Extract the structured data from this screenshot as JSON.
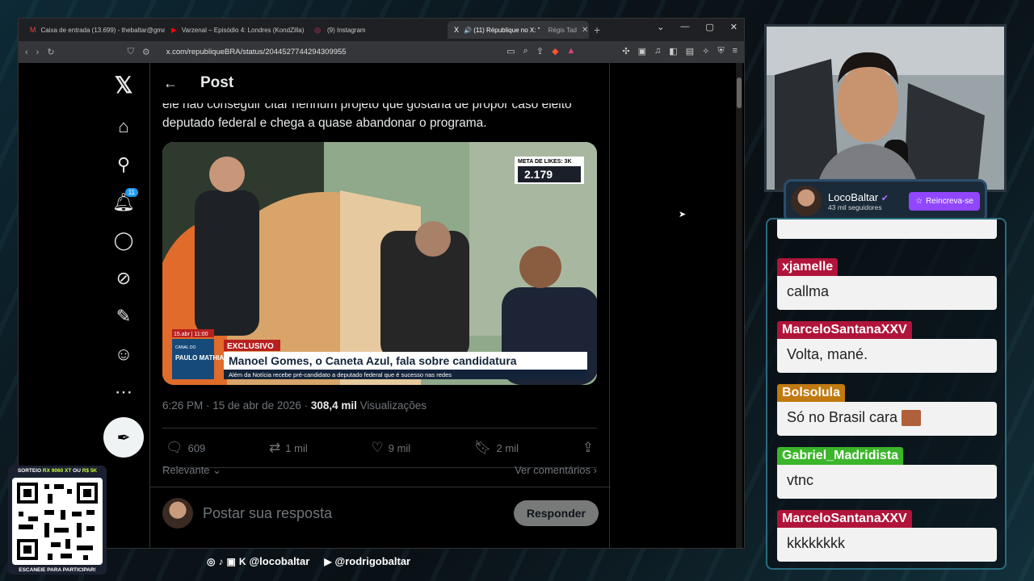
{
  "browser": {
    "tabs": [
      {
        "icon": "M",
        "label": "Caixa de entrada (13.699) - thebaltar@gmail.com",
        "active": false
      },
      {
        "icon": "▶",
        "label": "Varzenal – Episódio 4: Londres (KondZilla) -",
        "active": false
      },
      {
        "icon": "◎",
        "label": "(9) Instagram",
        "active": false
      },
      {
        "icon": "X",
        "label": "🔊 (11) République no X: \"",
        "active": true
      },
      {
        "icon": "",
        "label": "Régis Tad",
        "active": false
      }
    ],
    "new_tab": "+",
    "url": "x.com/republiqueBRA/status/2044527744294309955"
  },
  "x": {
    "notif_badge": "11",
    "post_header": "Post",
    "tweet_text": "ele não conseguir citar nenhum projeto que gostaria de propor caso eleito deputado federal e chega a quase abandonar o programa.",
    "media": {
      "likes_goal": "META DE LIKES: 3K",
      "likes_count": "2.179",
      "date_tag": "15.abr | 11:00",
      "channel_tag": "PAULO MATHIAS",
      "channel_small": "CANAL DO",
      "exclusive": "EXCLUSIVO",
      "headline": "Manoel Gomes, o Caneta Azul, fala sobre candidatura",
      "subline": "Além da Notícia recebe pré-candidato a deputado federal que é sucesso nas redes"
    },
    "meta_time": "6:26 PM · 15 de abr de 2026 · ",
    "meta_views": "308,4 mil",
    "meta_views_label": " Visualizações",
    "actions": {
      "replies": "609",
      "reposts": "1 mil",
      "likes": "9 mil",
      "bookmarks": "2 mil"
    },
    "sort_label": "Relevante",
    "view_comments": "Ver comentários",
    "reply_placeholder": "Postar sua resposta",
    "reply_button": "Responder"
  },
  "stream": {
    "channel_name": "LocoBaltar",
    "followers": "43 mil seguidores",
    "subscribe": "Reincreva-se",
    "chat": [
      {
        "user": "xjamelle",
        "color": "#b0143a",
        "text": "callma"
      },
      {
        "user": "MarceloSantanaXXV",
        "color": "#b0143a",
        "text": "Volta, mané."
      },
      {
        "user": "Bolsolula",
        "color": "#c07a10",
        "text": "Só no Brasil cara"
      },
      {
        "user": "Gabriel_Madridista",
        "color": "#3bb52a",
        "text": "vtnc"
      },
      {
        "user": "MarceloSantanaXXV",
        "color": "#b0143a",
        "text": "kkkkkkkk"
      }
    ],
    "qr_top_a": "SORTEIO ",
    "qr_top_b": "RX 9060 XT",
    "qr_top_c": " OU ",
    "qr_top_d": "R$ 5K",
    "qr_bottom": "ESCANEIE PARA PARTICIPAR!",
    "social_a": "@locobaltar",
    "social_b": "@rodrigobaltar"
  }
}
